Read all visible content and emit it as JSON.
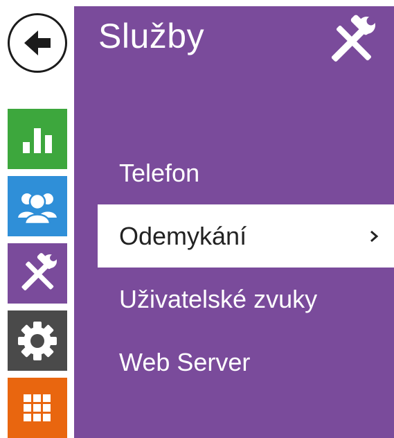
{
  "nav": {
    "back_icon": "arrow-left-icon",
    "tiles": [
      {
        "id": "status",
        "icon": "bar-chart-icon",
        "color": "#3da73d"
      },
      {
        "id": "users",
        "icon": "users-icon",
        "color": "#2f8fd8"
      },
      {
        "id": "services",
        "icon": "tools-icon",
        "color": "#7a4b9b"
      },
      {
        "id": "settings",
        "icon": "gear-icon",
        "color": "#4a4a4a"
      },
      {
        "id": "apps",
        "icon": "grid-icon",
        "color": "#e9660f"
      }
    ]
  },
  "panel": {
    "title": "Služby",
    "icon": "tools-icon",
    "accent": "#7a4b9b",
    "menu": [
      {
        "label": "Telefon",
        "selected": false
      },
      {
        "label": "Odemykání",
        "selected": true
      },
      {
        "label": "Uživatelské zvuky",
        "selected": false
      },
      {
        "label": "Web Server",
        "selected": false
      }
    ],
    "selected_chevron": "›"
  }
}
